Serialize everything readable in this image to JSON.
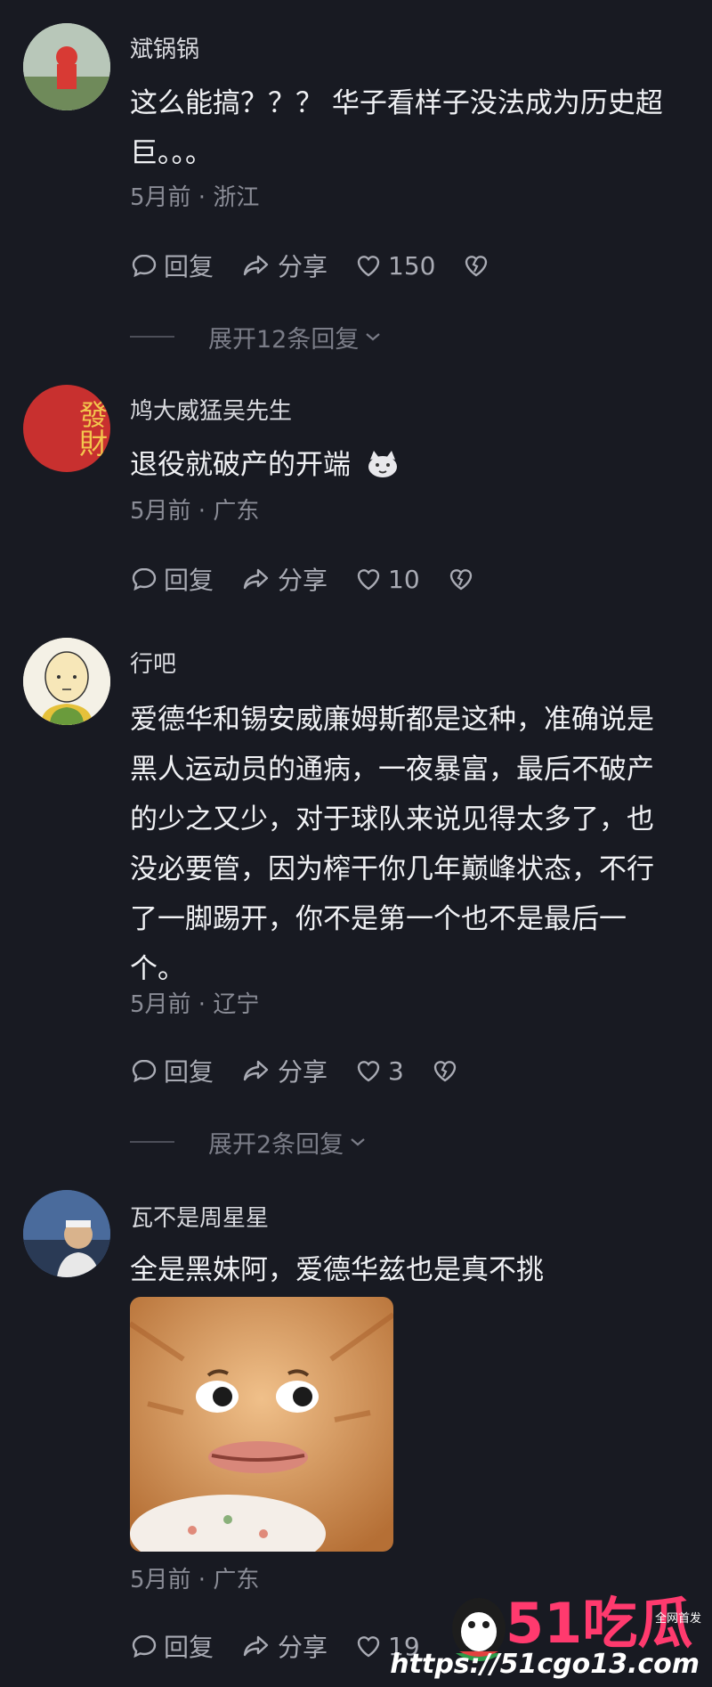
{
  "comments": [
    {
      "username": "斌锅锅",
      "text_lines": [
        "这么能搞？？？ 华子看样子没法成为历史超",
        "巨。。。"
      ],
      "meta": "5月前 · 浙江",
      "reply": "回复",
      "share": "分享",
      "likes": "150",
      "expand": "展开12条回复"
    },
    {
      "username": "鸠大威猛吴先生",
      "text_lines": [
        "退役就破产的开端"
      ],
      "meta": "5月前 · 广东",
      "reply": "回复",
      "share": "分享",
      "likes": "10",
      "avatar_text": "發財"
    },
    {
      "username": "行吧",
      "text_lines": [
        "爱德华和锡安威廉姆斯都是这种，准确说是",
        "黑人运动员的通病，一夜暴富，最后不破产",
        "的少之又少，对于球队来说见得太多了，也",
        "没必要管，因为榨干你几年巅峰状态，不行",
        "了一脚踢开，你不是第一个也不是最后一",
        "个。"
      ],
      "meta": "5月前 · 辽宁",
      "reply": "回复",
      "share": "分享",
      "likes": "3",
      "expand": "展开2条回复"
    },
    {
      "username": "瓦不是周星星",
      "text_lines": [
        "全是黑妹阿，爱德华兹也是真不挑"
      ],
      "meta": "5月前 · 广东",
      "reply": "回复",
      "share": "分享",
      "likes": "19"
    }
  ],
  "watermark": {
    "logo": "51吃瓜",
    "url": "https://51cgo13.com",
    "tag": "全网首发"
  },
  "colors": {
    "background": "#181a22",
    "text": "#f0f1f4",
    "muted": "#8a8c96",
    "accent": "#ff3a6e"
  }
}
